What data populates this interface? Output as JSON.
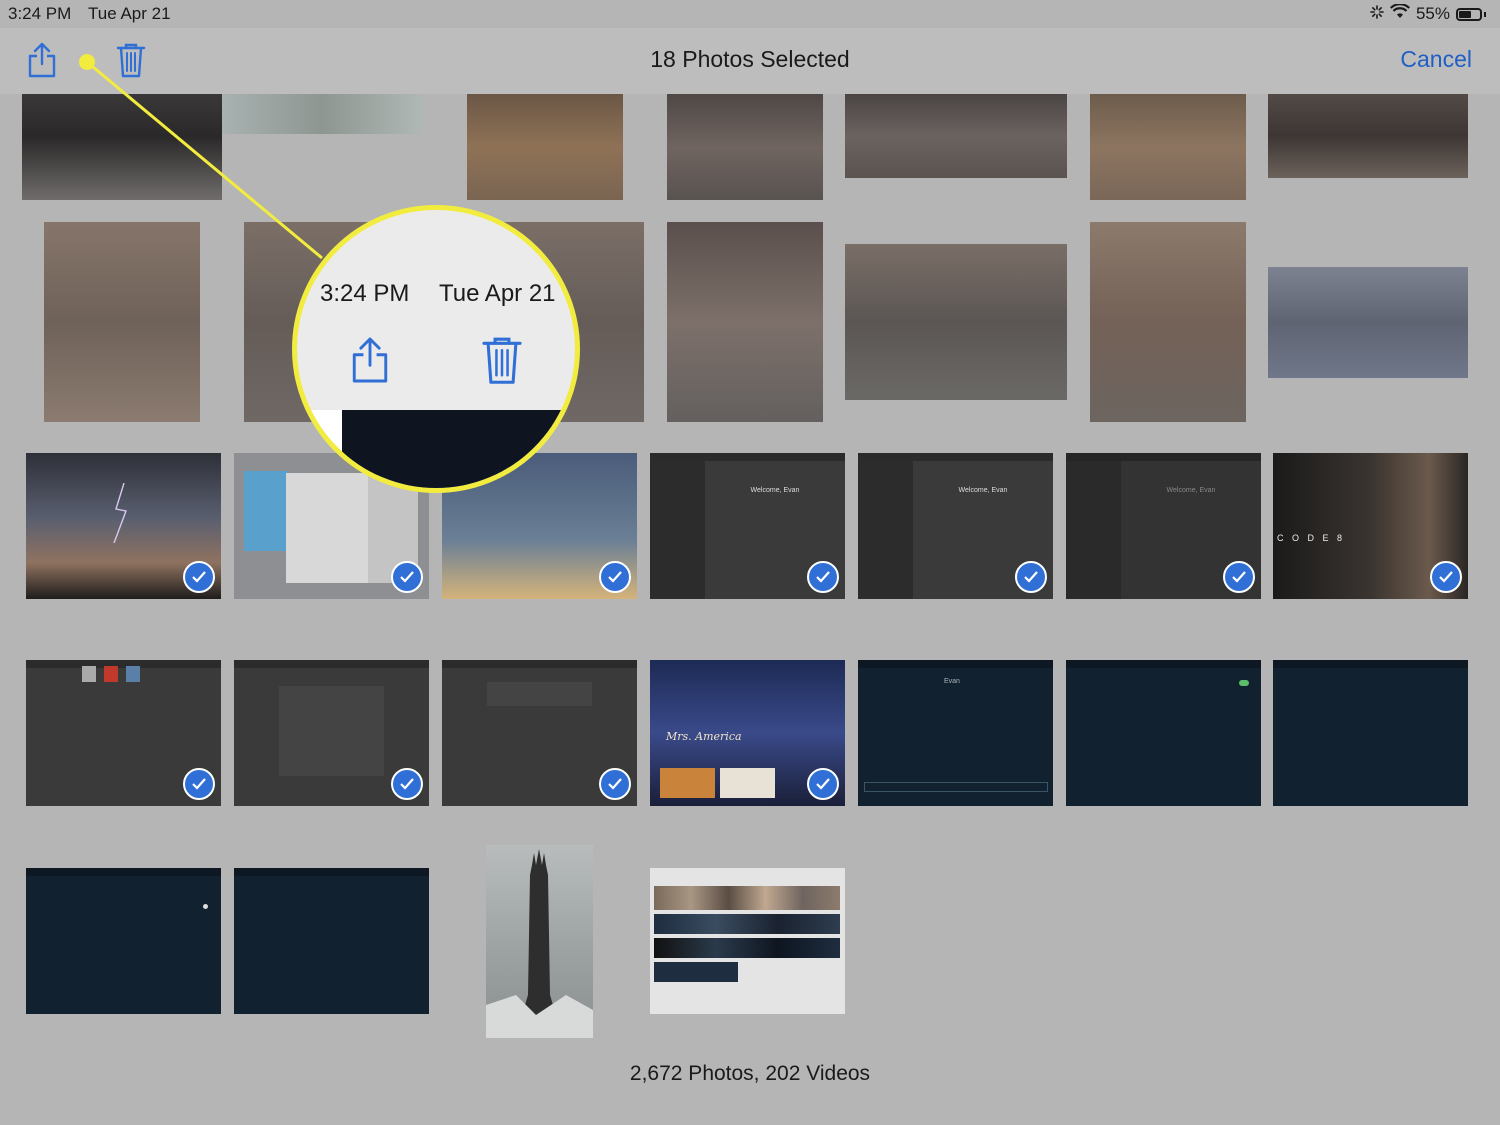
{
  "status": {
    "time": "3:24 PM",
    "date": "Tue Apr 21",
    "battery": "55%"
  },
  "nav": {
    "title": "18 Photos Selected",
    "cancel": "Cancel",
    "share_icon": "share-icon",
    "trash_icon": "trash-icon"
  },
  "callout": {
    "time": "3:24 PM",
    "date": "Tue Apr 21",
    "highlight_color": "#f2ec3f"
  },
  "screens": {
    "welcome_1": "Welcome, Evan",
    "welcome_2": "Welcome, Evan",
    "welcome_3": "Welcome, Evan",
    "evan": "Evan",
    "code": "C O D E 8",
    "mrs_america": "Mrs. America"
  },
  "footer": {
    "count": "2,672 Photos, 202 Videos"
  },
  "colors": {
    "accent": "#1f5fc6",
    "check": "#2f6fd6"
  }
}
